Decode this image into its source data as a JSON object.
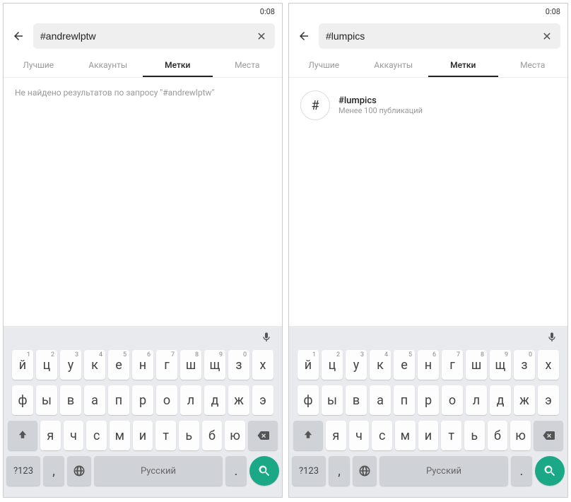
{
  "status_time": "0:08",
  "tabs": {
    "t0": "Лучшие",
    "t1": "Аккаунты",
    "t2": "Метки",
    "t3": "Места"
  },
  "left": {
    "search_value": "#andrewlptw",
    "no_results": "Не найдено результатов по запросу \"#andrewlptw\""
  },
  "right": {
    "search_value": "#lumpics",
    "result": {
      "title": "#lumpics",
      "sub": "Менее 100 публикаций"
    }
  },
  "keyboard": {
    "row1": [
      {
        "k": "й",
        "h": "1"
      },
      {
        "k": "ц",
        "h": "2"
      },
      {
        "k": "у",
        "h": "3"
      },
      {
        "k": "к",
        "h": "4"
      },
      {
        "k": "е",
        "h": "5"
      },
      {
        "k": "н",
        "h": "6"
      },
      {
        "k": "г",
        "h": "7"
      },
      {
        "k": "ш",
        "h": "8"
      },
      {
        "k": "щ",
        "h": "9"
      },
      {
        "k": "з",
        "h": "0"
      },
      {
        "k": "х",
        "h": ""
      }
    ],
    "row2": [
      "ф",
      "ы",
      "в",
      "а",
      "п",
      "р",
      "о",
      "л",
      "д",
      "ж",
      "э"
    ],
    "row3": [
      "я",
      "ч",
      "с",
      "м",
      "и",
      "т",
      "ь",
      "б",
      "ю"
    ],
    "special": "?123",
    "space": "Русский",
    "comma": ",",
    "period": "."
  }
}
